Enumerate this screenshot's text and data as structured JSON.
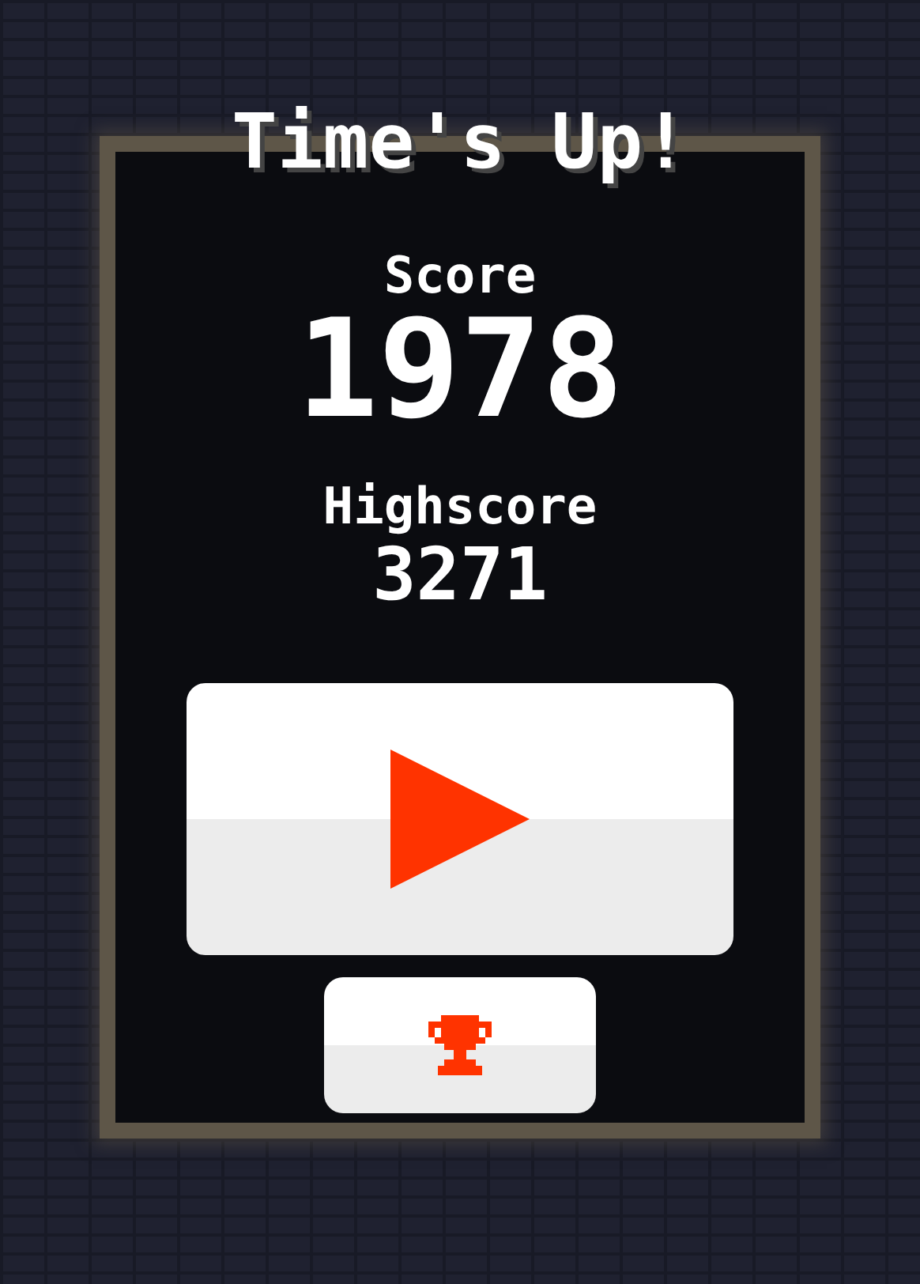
{
  "title": "Time's Up!",
  "score": {
    "label": "Score",
    "value": "1978"
  },
  "highscore": {
    "label": "Highscore",
    "value": "3271"
  },
  "buttons": [
    {
      "kind": "play"
    },
    {
      "kind": "trophy"
    }
  ]
}
